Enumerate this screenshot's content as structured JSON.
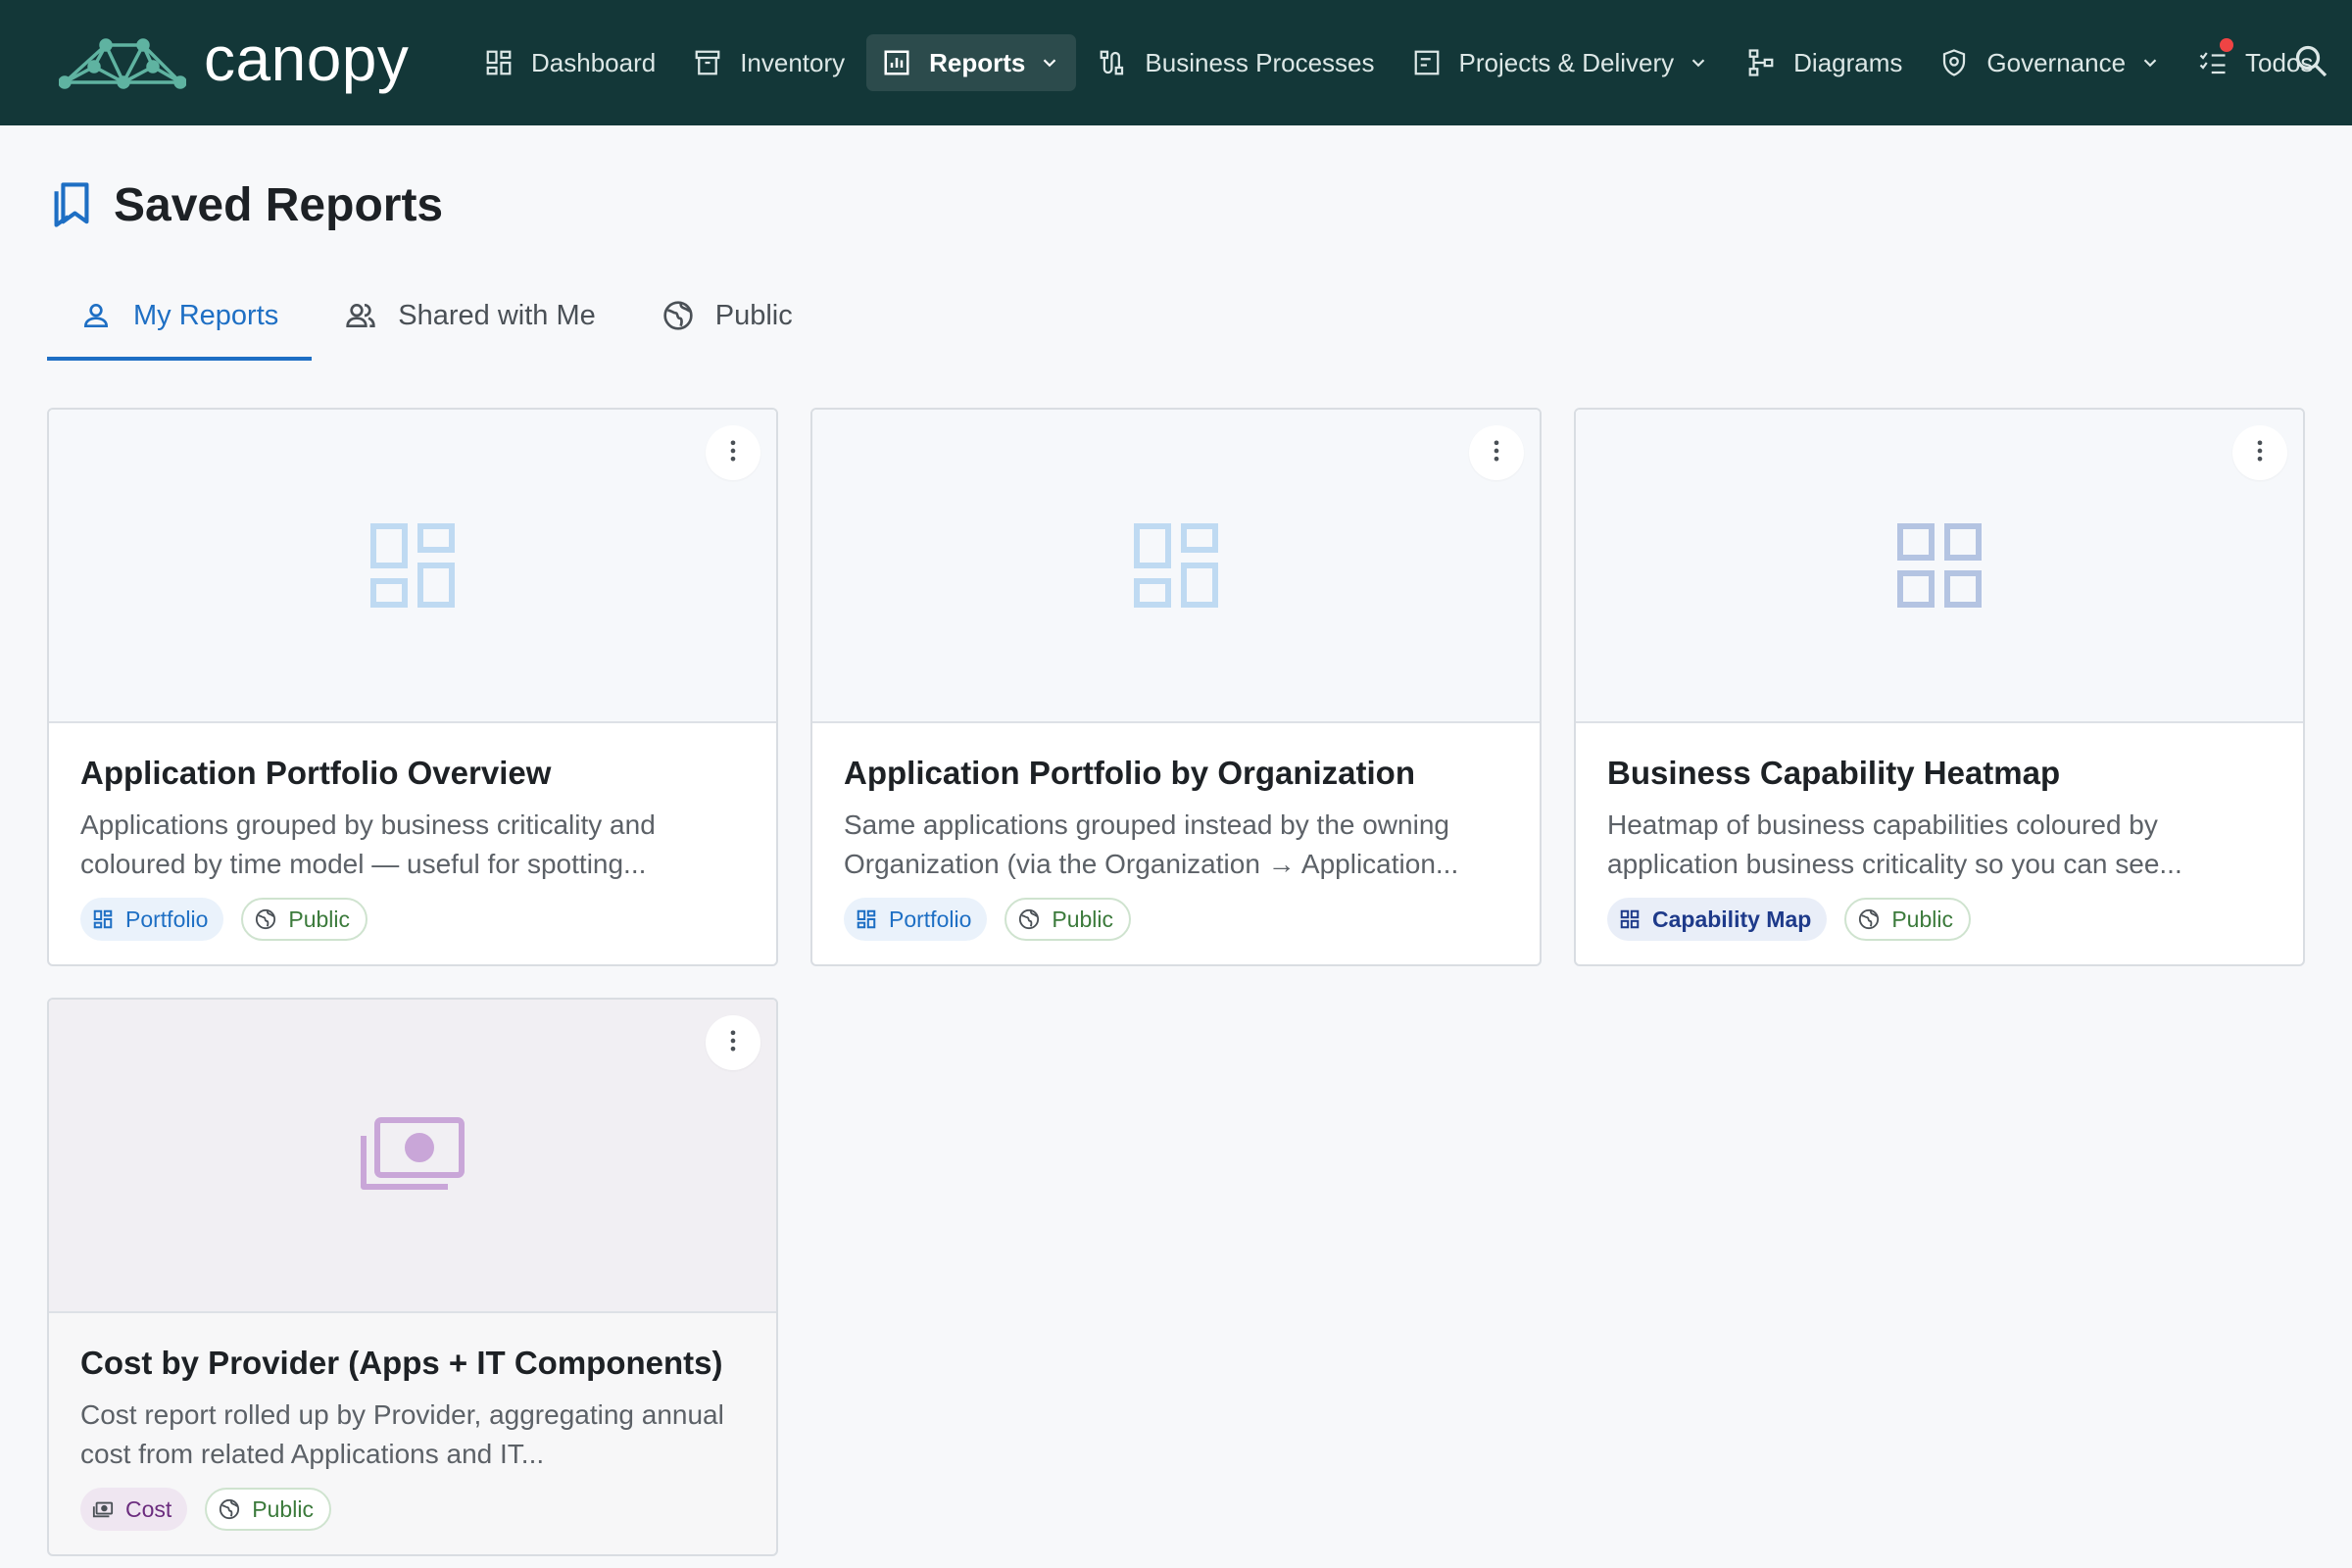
{
  "brand": {
    "name": "canopy"
  },
  "nav": {
    "items": [
      {
        "label": "Dashboard",
        "icon": "dashboard-icon"
      },
      {
        "label": "Inventory",
        "icon": "archive-icon"
      },
      {
        "label": "Reports",
        "icon": "report-chart-icon",
        "active": true,
        "has_menu": true
      },
      {
        "label": "Business Processes",
        "icon": "process-icon"
      },
      {
        "label": "Projects & Delivery",
        "icon": "project-icon",
        "has_menu": true
      },
      {
        "label": "Diagrams",
        "icon": "diagram-icon"
      },
      {
        "label": "Governance",
        "icon": "governance-shield-icon",
        "has_menu": true
      },
      {
        "label": "Todos",
        "icon": "todo-list-icon",
        "has_notification": true
      }
    ],
    "search_icon": "search-icon"
  },
  "page": {
    "title": "Saved Reports",
    "title_icon": "bookmarks-icon"
  },
  "tabs": [
    {
      "label": "My Reports",
      "icon": "person-icon",
      "active": true
    },
    {
      "label": "Shared with Me",
      "icon": "people-icon"
    },
    {
      "label": "Public",
      "icon": "globe-icon"
    }
  ],
  "cards": [
    {
      "title": "Application Portfolio Overview",
      "description": "Applications grouped by business criticality and coloured by time model — useful for spotting...",
      "type": {
        "label": "Portfolio",
        "icon": "portfolio-grid-icon"
      },
      "visibility": {
        "label": "Public",
        "icon": "globe-icon"
      },
      "thumbnail_icon": "portfolio-grid-icon"
    },
    {
      "title": "Application Portfolio by Organization",
      "description": "Same applications grouped instead by the owning Organization (via the Organization → Application...",
      "type": {
        "label": "Portfolio",
        "icon": "portfolio-grid-icon"
      },
      "visibility": {
        "label": "Public",
        "icon": "globe-icon"
      },
      "thumbnail_icon": "portfolio-grid-icon"
    },
    {
      "title": "Business Capability Heatmap",
      "description": "Heatmap of business capabilities coloured by application business criticality so you can see...",
      "type": {
        "label": "Capability Map",
        "icon": "capability-grid-icon"
      },
      "visibility": {
        "label": "Public",
        "icon": "globe-icon"
      },
      "thumbnail_icon": "capability-grid-icon"
    },
    {
      "title": "Cost by Provider (Apps + IT Components)",
      "description": "Cost report rolled up by Provider, aggregating annual cost from related Applications and IT...",
      "type": {
        "label": "Cost",
        "icon": "money-icon"
      },
      "visibility": {
        "label": "Public",
        "icon": "globe-icon"
      },
      "thumbnail_icon": "money-icon"
    }
  ],
  "colors": {
    "topbar": "#133738",
    "accent": "#1e6fc4",
    "notification": "#ef4444",
    "public_chip": "#3b7a3b",
    "cost_chip": "#6b2c7e"
  }
}
